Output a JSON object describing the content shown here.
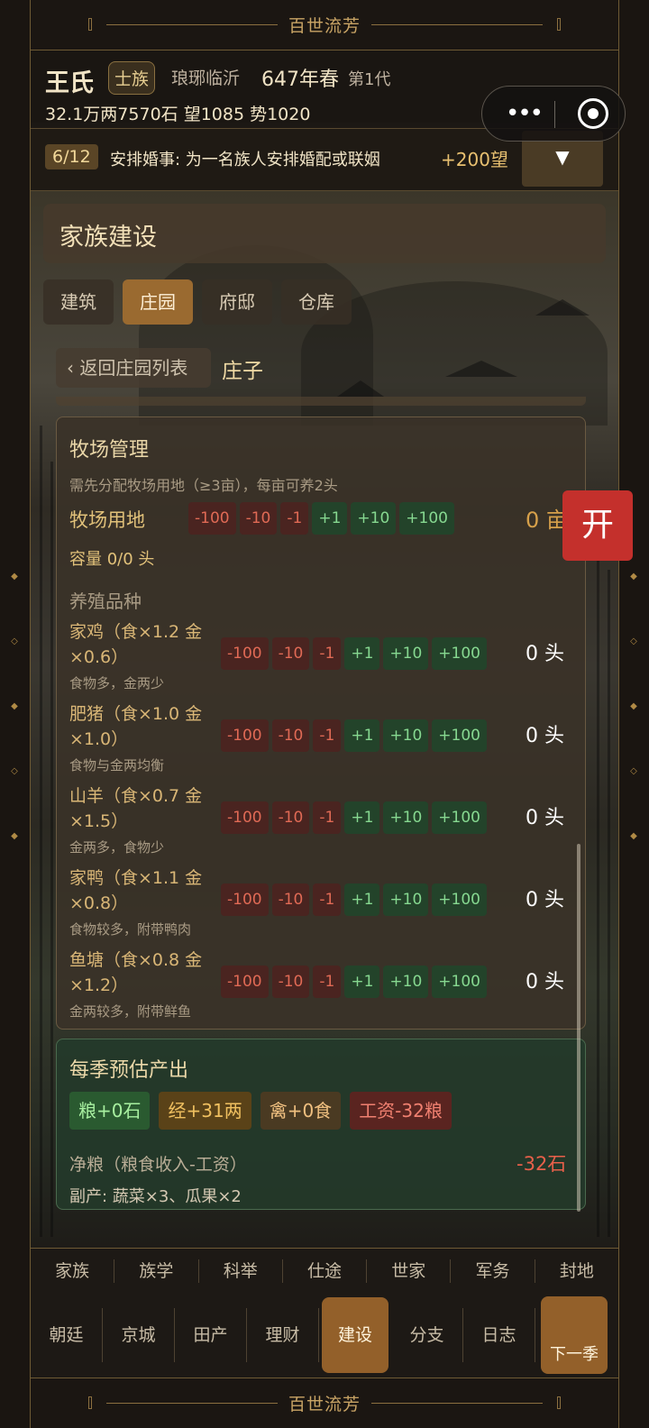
{
  "banner": {
    "title": "百世流芳"
  },
  "header": {
    "clan_name": "王氏",
    "rank": "士族",
    "origin": "琅琊临沂",
    "year": "647年春",
    "generation": "第1代",
    "stats": "32.1万两7570石  望1085 势1020"
  },
  "task": {
    "progress": "6/12",
    "text": "安排婚事: 为一名族人安排婚配或联姻",
    "reward": "+200望",
    "toggle_icon": "▼"
  },
  "section": {
    "title": "家族建设",
    "tabs": [
      "建筑",
      "庄园",
      "府邸",
      "仓库"
    ],
    "active_tab": "庄园",
    "back_label": "‹ 返回庄园列表",
    "sub_title": "庄子"
  },
  "ranch": {
    "title": "牧场管理",
    "note": "需先分配牧场用地（≥3亩），每亩可养2头",
    "land_label": "牧场用地",
    "land_value": "0 亩",
    "capacity": "容量 0/0 头",
    "breed_title": "养殖品种",
    "adjust_buttons": [
      "-100",
      "-10",
      "-1",
      "+1",
      "+10",
      "+100"
    ],
    "breeds": [
      {
        "name": "家鸡（食×1.2 金×0.6）",
        "desc": "食物多，金两少",
        "count": "0 头"
      },
      {
        "name": "肥猪（食×1.0 金×1.0）",
        "desc": "食物与金两均衡",
        "count": "0 头"
      },
      {
        "name": "山羊（食×0.7 金×1.5）",
        "desc": "金两多，食物少",
        "count": "0 头"
      },
      {
        "name": "家鸭（食×1.1 金×0.8）",
        "desc": "食物较多，附带鸭肉",
        "count": "0 头"
      },
      {
        "name": "鱼塘（食×0.8 金×1.2）",
        "desc": "金两较多，附带鲜鱼",
        "count": "0 头"
      }
    ]
  },
  "output": {
    "title": "每季预估产出",
    "chips": {
      "grain": "粮+0石",
      "gold": "经+31两",
      "fowl": "禽+0食",
      "wage": "工资-32粮"
    },
    "net_label": "净粮（粮食收入-工资）",
    "net_value": "-32石",
    "byproduct": "副产: 蔬菜×3、瓜果×2"
  },
  "float_button": "开",
  "nav_top": [
    "家族",
    "族学",
    "科举",
    "仕途",
    "世家",
    "军务",
    "封地"
  ],
  "nav_bottom": [
    "朝廷",
    "京城",
    "田产",
    "理财",
    "建设",
    "分支",
    "日志"
  ],
  "nav_active": "建设",
  "next_season": "下一季",
  "colors": {
    "accent": "#9a6a30",
    "danger": "#c4302c",
    "gold_text": "#e2c27a"
  }
}
